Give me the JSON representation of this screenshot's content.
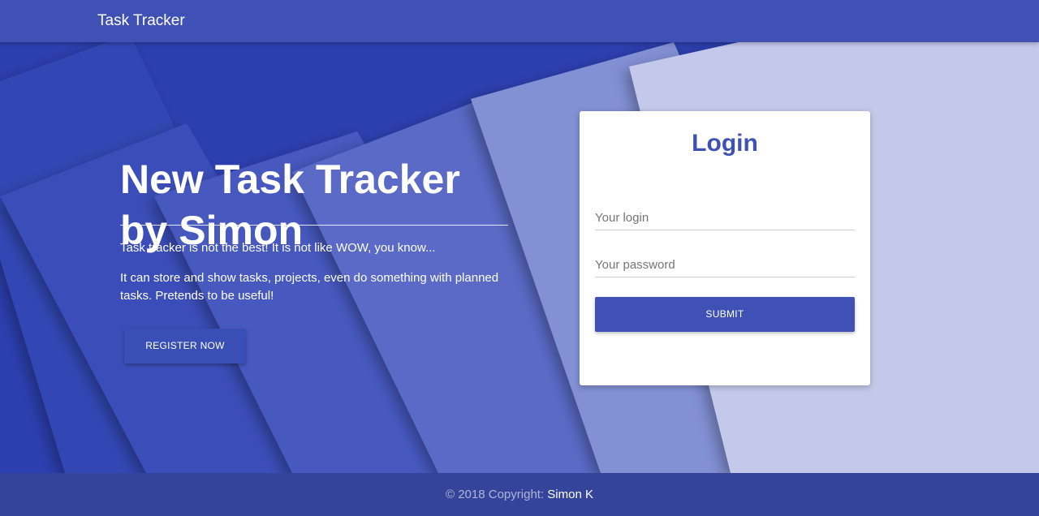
{
  "navbar": {
    "brand": "Task Tracker"
  },
  "hero": {
    "headline_line1": "New Task Tracker",
    "headline_line2": "by Simon",
    "paragraph1": "Task tracker is not the best! It is not like WOW, you know...",
    "paragraph2": "It can store and show tasks, projects, even do something with planned tasks. Pretends to be useful!",
    "register_label": "REGISTER NOW"
  },
  "login": {
    "title": "Login",
    "login_placeholder": "Your login",
    "login_value": "",
    "password_placeholder": "Your password",
    "password_value": "",
    "submit_label": "SUBMIT"
  },
  "footer": {
    "copyright": "© 2018 Copyright:",
    "author": "Simon K"
  },
  "colors": {
    "primary": "#3f51b5",
    "footer": "#34449a",
    "hero_light": "#c5cae9"
  }
}
